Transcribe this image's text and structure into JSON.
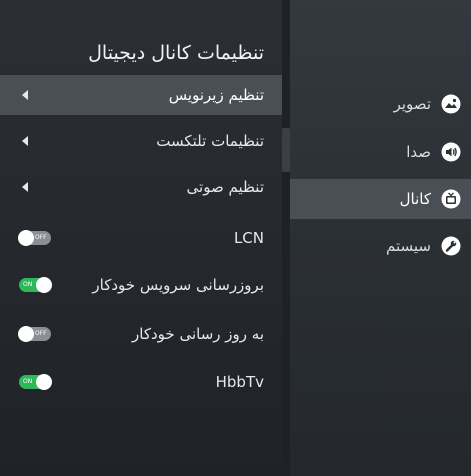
{
  "settings_panel": {
    "title": "تنظیمات کانال دیجیتال",
    "items": [
      {
        "label": "تنظیم زیرنویس",
        "control": "arrow",
        "selected": true
      },
      {
        "label": "تنظیمات تلتکست",
        "control": "arrow",
        "selected": false
      },
      {
        "label": "تنظیم صوتی",
        "control": "arrow",
        "selected": false
      },
      {
        "label": "LCN",
        "control": "toggle",
        "state": "OFF"
      },
      {
        "label": "بروزرسانی سرویس خودکار",
        "control": "toggle",
        "state": "ON"
      },
      {
        "label": "به روز رسانی خودکار",
        "control": "toggle",
        "state": "OFF"
      },
      {
        "label": "HbbTv",
        "control": "toggle",
        "state": "ON"
      }
    ]
  },
  "main_menu": {
    "items": [
      {
        "label": "تصویر",
        "icon": "picture-icon",
        "selected": false
      },
      {
        "label": "صدا",
        "icon": "speaker-icon",
        "selected": false
      },
      {
        "label": "کانال",
        "icon": "tv-icon",
        "selected": true
      },
      {
        "label": "سیستم",
        "icon": "wrench-icon",
        "selected": false
      }
    ]
  },
  "colors": {
    "toggle_on": "#2fb85a",
    "toggle_off": "#8a8f95",
    "selected_row": "#4a4f55"
  }
}
